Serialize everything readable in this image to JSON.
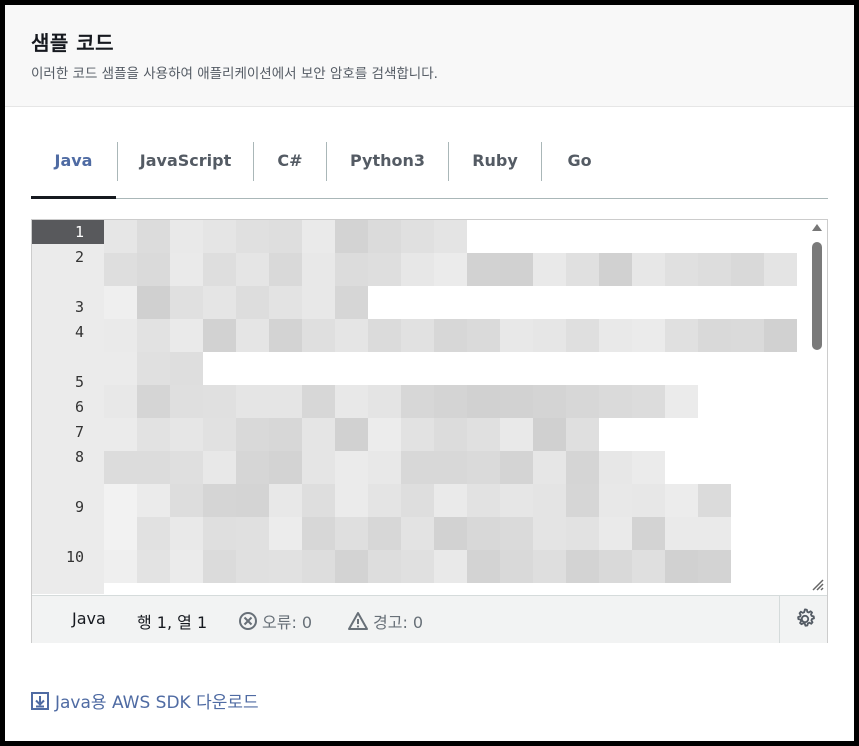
{
  "header": {
    "title": "샘플 코드",
    "subtitle": "이러한 코드 샘플을 사용하여 애플리케이션에서 보안 암호를 검색합니다."
  },
  "tabs": [
    {
      "label": "Java",
      "active": true
    },
    {
      "label": "JavaScript",
      "active": false
    },
    {
      "label": "C#",
      "active": false
    },
    {
      "label": "Python3",
      "active": false
    },
    {
      "label": "Ruby",
      "active": false
    },
    {
      "label": "Go",
      "active": false
    }
  ],
  "editor": {
    "line_numbers": [
      "1",
      "2",
      "3",
      "4",
      "5",
      "6",
      "7",
      "8",
      "9",
      "10"
    ],
    "current_line": "1"
  },
  "statusbar": {
    "language": "Java",
    "position": "행 1, 열 1",
    "errors": "오류: 0",
    "warnings": "경고: 0"
  },
  "download_link": "Java용 AWS SDK 다운로드",
  "colors": {
    "accent": "#4f6ba3",
    "active_tab_underline": "#16191f",
    "gutter_current": "#58595c"
  },
  "icons": {
    "error": "x-circle-icon",
    "warning": "warning-triangle-icon",
    "settings": "gear-icon",
    "download": "download-icon"
  }
}
